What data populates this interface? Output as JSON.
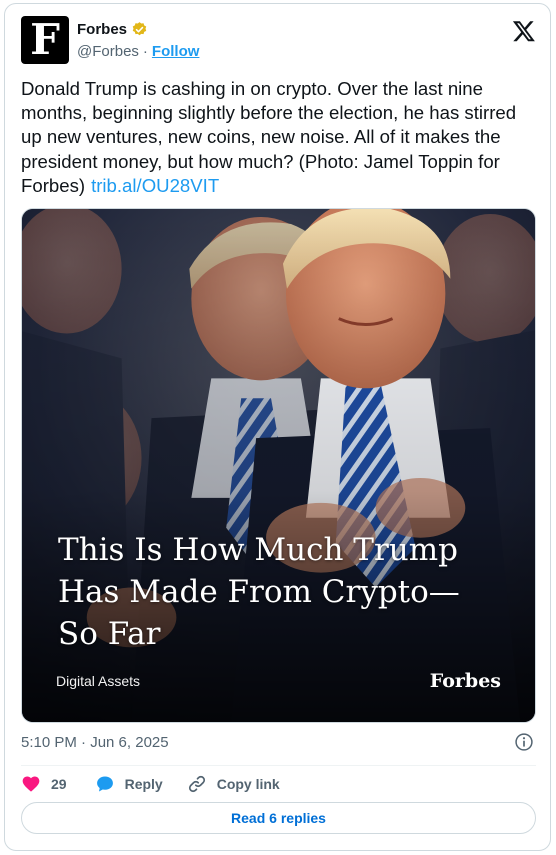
{
  "author": {
    "avatar_letter": "F",
    "display_name": "Forbes",
    "handle": "@Forbes",
    "separator": "·",
    "follow_label": "Follow",
    "verified_color": "#e2b719"
  },
  "platform_icon": "x-logo-icon",
  "tweet": {
    "text": "Donald Trump is cashing in on crypto. Over the last nine months, beginning slightly before the election, he has stirred up new ventures, new coins, new noise. All of it makes the president money, but how much? (Photo: Jamel Toppin for Forbes)",
    "link_text": "trib.al/OU28VIT"
  },
  "media": {
    "headline": "This Is How Much Trump\nHas Made From Crypto—\nSo Far",
    "section": "Digital Assets",
    "brand": "Forbes"
  },
  "timestamp": "5:10 PM · Jun 6, 2025",
  "actions": {
    "like_count": "29",
    "reply_label": "Reply",
    "copy_link_label": "Copy link"
  },
  "read_replies_label": "Read 6 replies",
  "colors": {
    "accent": "#1d9bf0",
    "like": "#f91880",
    "reply_icon": "#1d9bf0",
    "muted": "#536471"
  }
}
